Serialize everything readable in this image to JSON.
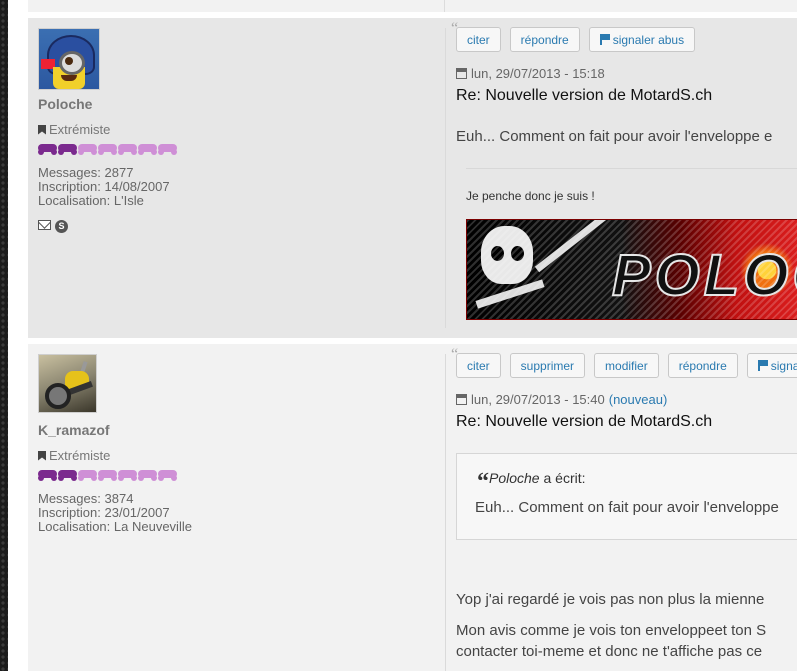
{
  "posts": [
    {
      "username": "Poloche",
      "rank": "Extrémiste",
      "stars_full": 2,
      "stars_total": 7,
      "stats": {
        "messages_label": "Messages:",
        "messages": "2877",
        "inscription_label": "Inscription:",
        "inscription": "14/08/2007",
        "localisation_label": "Localisation:",
        "localisation": "L'Isle"
      },
      "actions": {
        "citer": "citer",
        "repondre": "répondre",
        "signaler": "signaler abus"
      },
      "date": "lun, 29/07/2013 - 15:18",
      "title": "Re: Nouvelle version de MotardS.ch",
      "body": "Euh... Comment on fait pour avoir l'enveloppe e",
      "signature": "Je penche donc je suis !",
      "banner_text": "POLOC"
    },
    {
      "username": "K_ramazof",
      "rank": "Extrémiste",
      "stars_full": 2,
      "stars_total": 7,
      "stats": {
        "messages_label": "Messages:",
        "messages": "3874",
        "inscription_label": "Inscription:",
        "inscription": "23/01/2007",
        "localisation_label": "Localisation:",
        "localisation": "La Neuveville"
      },
      "actions": {
        "citer": "citer",
        "supprimer": "supprimer",
        "modifier": "modifier",
        "repondre": "répondre",
        "signaler": "signa"
      },
      "date": "lun, 29/07/2013 - 15:40",
      "new_label": "(nouveau)",
      "title": "Re: Nouvelle version de MotardS.ch",
      "quote": {
        "author": "Poloche",
        "wrote": "a écrit:",
        "text": "Euh... Comment on fait pour avoir l'enveloppe"
      },
      "body_lines": [
        "Yop j'ai regardé je vois pas non plus la mienne",
        "Mon avis comme je vois ton enveloppeet ton S",
        "contacter toi-meme et donc ne t'affiche pas ce"
      ]
    }
  ]
}
